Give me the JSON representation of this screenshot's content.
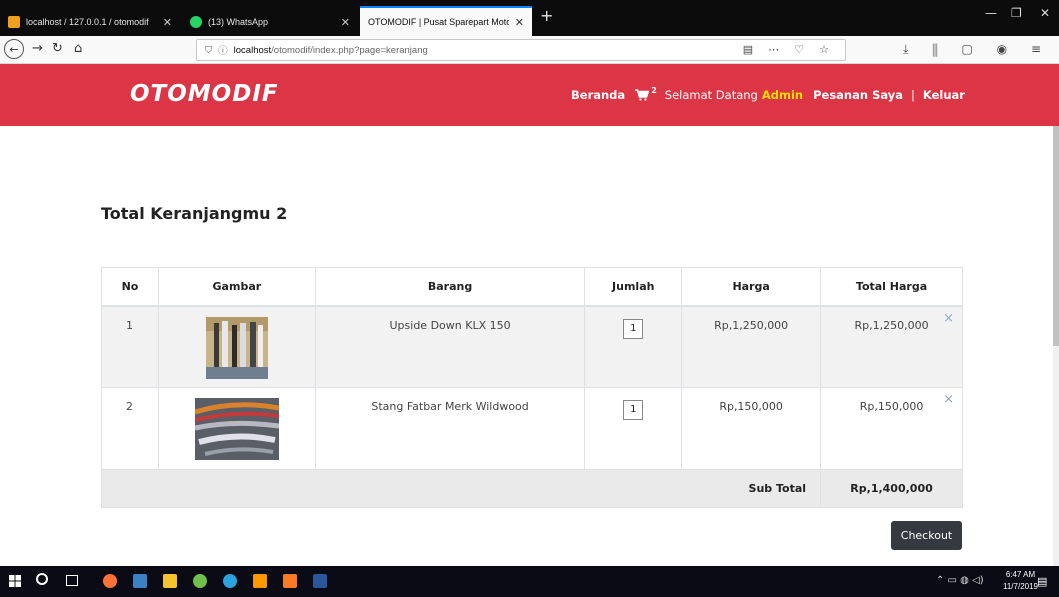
{
  "browser": {
    "tabs": [
      {
        "title": "localhost / 127.0.0.1 / otomodif",
        "active": false
      },
      {
        "title": "(13) WhatsApp",
        "active": false
      },
      {
        "title": "OTOMODIF | Pusat Sparepart Motor",
        "active": true
      }
    ],
    "url": {
      "host": "localhost",
      "path": "/otomodif/index.php?page=keranjang"
    }
  },
  "site": {
    "logo": "OTOMODIF",
    "menu": {
      "home": "Beranda",
      "cart_count": "2",
      "welcome": "Selamat Datang",
      "user": "Admin",
      "orders": "Pesanan Saya",
      "separator": "|",
      "logout": "Keluar"
    }
  },
  "cart": {
    "heading": "Total Keranjangmu 2",
    "columns": [
      "No",
      "Gambar",
      "Barang",
      "Jumlah",
      "Harga",
      "Total Harga"
    ],
    "items": [
      {
        "no": "1",
        "name": "Upside Down KLX 150",
        "qty": "1",
        "price": "Rp,1,250,000",
        "total": "Rp,1,250,000"
      },
      {
        "no": "2",
        "name": "Stang Fatbar Merk Wildwood",
        "qty": "1",
        "price": "Rp,150,000",
        "total": "Rp,150,000"
      }
    ],
    "remove_symbol": "×",
    "subtotal_label": "Sub Total",
    "subtotal_value": "Rp,1,400,000",
    "checkout_label": "Checkout"
  },
  "taskbar": {
    "time": "6:47 AM",
    "date": "11/7/2019"
  },
  "colors": {
    "header_red": "#dc3545",
    "admin_yellow": "#ffdd00",
    "checkout_dark": "#343a40"
  }
}
